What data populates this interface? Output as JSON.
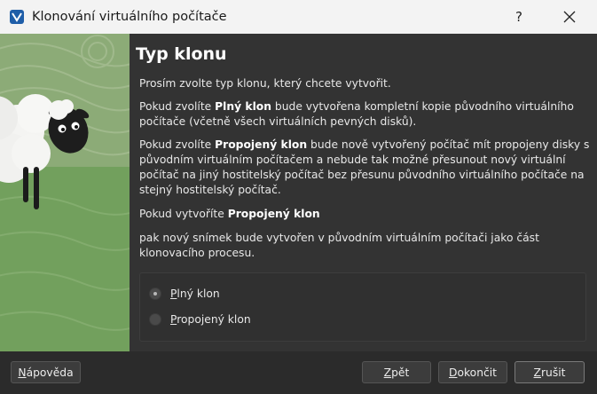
{
  "window": {
    "title": "Klonování virtuálního počítače",
    "help_label": "?"
  },
  "page": {
    "heading": "Typ klonu",
    "intro": "Prosím zvolte typ klonu, který chcete vytvořit.",
    "full_pre": "Pokud zvolíte ",
    "full_bold": "Plný klon",
    "full_post": " bude vytvořena kompletní kopie původního virtuálního počítače (včetně všech virtuálních pevných disků).",
    "linked_pre": "Pokud zvolíte ",
    "linked_bold": "Propojený klon",
    "linked_post": " bude nově vytvořený počítač mít propojeny disky s původním virtuálním počítačem a nebude tak možné přesunout nový virtuální počítač na jiný hostitelský počítač bez přesunu původního virtuálního počítače na stejný hostitelský počítač.",
    "create_pre": "Pokud vytvoříte ",
    "create_bold": "Propojený klon",
    "snapshot_note": "pak nový snímek bude vytvořen v původním virtuálním počítači jako část klonovacího procesu."
  },
  "clone_type": {
    "selected": "full",
    "options": [
      {
        "id": "full",
        "mnemonic": "P",
        "rest": "lný klon",
        "checked": true
      },
      {
        "id": "linked",
        "mnemonic": "P",
        "rest": "ropojený klon",
        "checked": false
      }
    ]
  },
  "buttons": {
    "help": {
      "mnemonic": "N",
      "rest": "ápověda"
    },
    "back": {
      "mnemonic": "Z",
      "rest": "pět"
    },
    "finish": {
      "mnemonic": "D",
      "rest": "okončit"
    },
    "cancel": {
      "mnemonic": "Z",
      "rest": "rušit"
    }
  },
  "colors": {
    "window_bg": "#333333",
    "titlebar_bg": "#f3f3f3",
    "banner_green": "#6f9a5b",
    "footer_bg": "#2b2b2b"
  },
  "icons": {
    "app": "virtualbox-icon",
    "close": "close-icon",
    "banner": "sheep-illustration"
  }
}
